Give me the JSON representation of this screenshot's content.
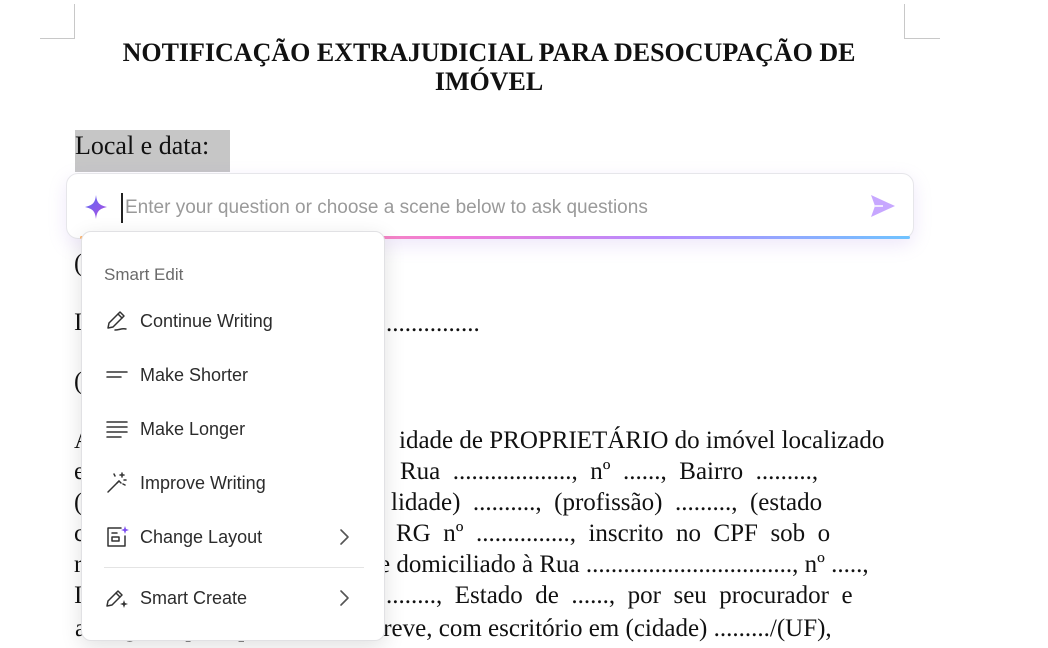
{
  "document": {
    "title_line1": "NOTIFICAÇÃO EXTRAJUDICIAL PARA DESOCUPAÇÃO DE",
    "title_line2": "IMÓVEL",
    "local_data": "Local e data:",
    "edge_chars": [
      "(",
      "I",
      "(",
      "A",
      "e",
      "(",
      "c",
      "r",
      "I"
    ],
    "partial_line_dots": "...............",
    "body_lines": [
      "idade de PROPRIETÁRIO do imóvel localizado",
      "Rua  ...................,  nº  ......,  Bairro  .........,",
      "lidade)  ..........,  (profissão)  .........,  (estado",
      "RG  nº  ...............,  inscrito  no  CPF  sob  o",
      "e domiciliado à Rua ................................., nº .....,",
      "........,  Estado  de  ......,  por  seu  procurador  e",
      "advogado que a presente subscreve, com escritório em (cidade) ........./(UF),"
    ]
  },
  "ai_bar": {
    "placeholder": "Enter your question or choose a scene below to ask questions",
    "spark_icon": "sparkle-icon",
    "send_icon": "send-icon"
  },
  "menu": {
    "header": "Smart Edit",
    "items": [
      {
        "label": "Continue Writing",
        "icon": "pen-icon"
      },
      {
        "label": "Make Shorter",
        "icon": "short-lines-icon"
      },
      {
        "label": "Make Longer",
        "icon": "long-lines-icon"
      },
      {
        "label": "Improve Writing",
        "icon": "magic-wand-icon"
      },
      {
        "label": "Change Layout",
        "icon": "layout-icon"
      },
      {
        "label": "Smart Create",
        "icon": "pen-sparkle-icon"
      }
    ]
  },
  "colors": {
    "accent_purple": "#7b4cf0",
    "send_purple": "#c7a7ff",
    "highlight_gray": "#c6c6c6"
  }
}
